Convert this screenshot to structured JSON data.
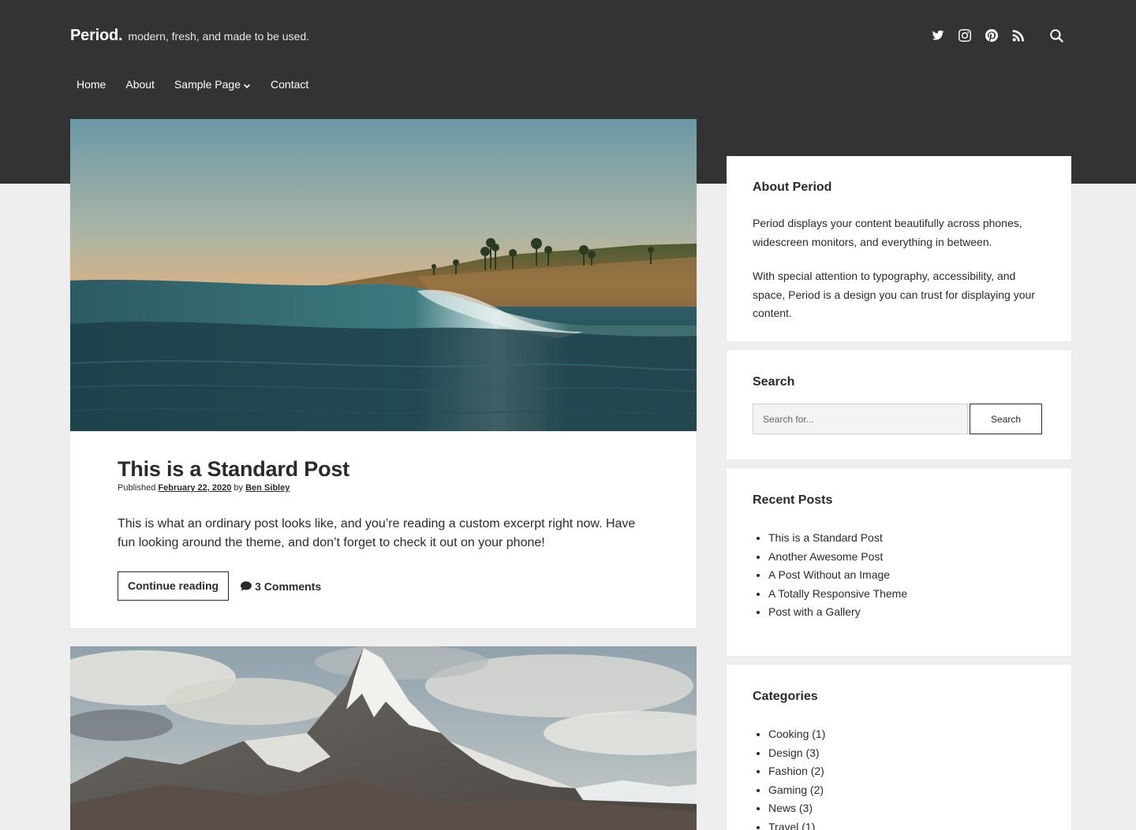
{
  "site": {
    "title": "Period.",
    "tagline": "modern, fresh, and made to be used."
  },
  "social": [
    {
      "icon": "twitter-icon"
    },
    {
      "icon": "instagram-icon"
    },
    {
      "icon": "pinterest-icon"
    },
    {
      "icon": "rss-icon"
    },
    {
      "icon": "search-icon"
    }
  ],
  "nav": {
    "items": [
      "Home",
      "About",
      "Sample Page",
      "Contact"
    ]
  },
  "posts": [
    {
      "title": "This is a Standard Post",
      "published_label": "Published",
      "date": "February 22, 2020",
      "by_label": "by",
      "author": "Ben Sibley",
      "excerpt": "This is what an ordinary post looks like, and you’re reading a custom excerpt right now. Have fun looking around the theme, and don’t forget to check it out on your phone!",
      "continue_label": "Continue reading",
      "comments": "3 Comments"
    }
  ],
  "sidebar": {
    "about": {
      "title": "About Period",
      "p1": "Period displays your content beautifully across phones, widescreen monitors, and everything in between.",
      "p2": "With special attention to typography, accessibility, and space, Period is a design you can trust for displaying your content."
    },
    "search": {
      "title": "Search",
      "placeholder": "Search for...",
      "button": "Search"
    },
    "recent": {
      "title": "Recent Posts",
      "items": [
        "This is a Standard Post",
        "Another Awesome Post",
        "A Post Without an Image",
        "A Totally Responsive Theme",
        "Post with a Gallery"
      ]
    },
    "categories": {
      "title": "Categories",
      "items": [
        "Cooking (1)",
        "Design (3)",
        "Fashion (2)",
        "Gaming (2)",
        "News (3)",
        "Travel (1)"
      ]
    }
  },
  "colors": {
    "header_bg": "#333333",
    "page_bg": "#eeeeee",
    "text": "#2a2a2a"
  }
}
